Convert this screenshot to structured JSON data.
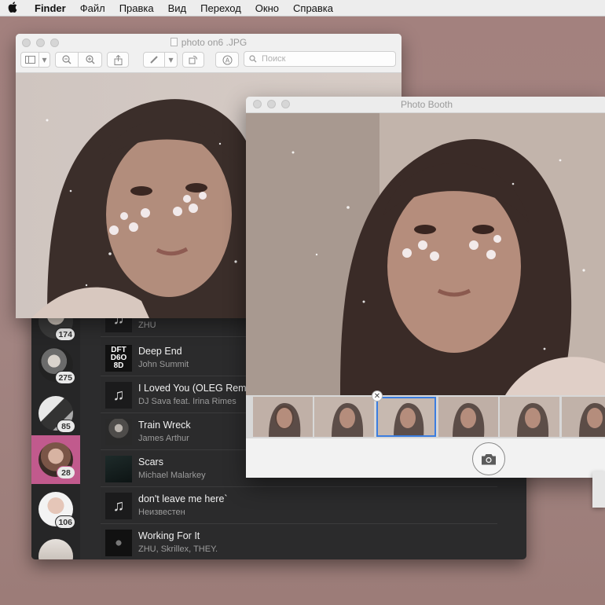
{
  "menubar": {
    "app": "Finder",
    "items": [
      "Файл",
      "Правка",
      "Вид",
      "Переход",
      "Окно",
      "Справка"
    ]
  },
  "preview": {
    "title": "photo on6 .JPG",
    "search_placeholder": "Поиск",
    "toolbar_icons": [
      "sidebar-icon",
      "zoom-out-icon",
      "zoom-in-icon",
      "share-icon",
      "markup-pen-icon",
      "rotate-icon",
      "annotate-icon",
      "search-icon"
    ]
  },
  "booth": {
    "title": "Photo Booth",
    "thumbnail_count": 6,
    "selected_thumbnail": 3
  },
  "music": {
    "playlists": [
      {
        "badge": "174",
        "active": false
      },
      {
        "badge": "275",
        "active": false
      },
      {
        "badge": "85",
        "active": false
      },
      {
        "badge": "28",
        "active": true
      },
      {
        "badge": "106",
        "active": false
      },
      {
        "badge": "",
        "active": false
      }
    ],
    "tracks": [
      {
        "title": "",
        "artist": "ZHU",
        "art": "note-icon"
      },
      {
        "title": "Deep End",
        "artist": "John Summit",
        "art": "album-art"
      },
      {
        "title": "I Loved You (OLEG Remix",
        "artist": "DJ Sava feat. Irina Rimes",
        "art": "note-icon"
      },
      {
        "title": "Train Wreck",
        "artist": "James Arthur",
        "art": "album-art"
      },
      {
        "title": "Scars",
        "artist": "Michael Malarkey",
        "art": "album-art"
      },
      {
        "title": "don't leave me here`",
        "artist": "Неизвестен",
        "art": "note-icon"
      },
      {
        "title": "Working For It",
        "artist": "ZHU, Skrillex, THEY.",
        "art": "album-art"
      }
    ],
    "album_text": "DFT D6O 8D"
  },
  "colors": {
    "desktop": "#a3817e",
    "active_playlist": "#c15a8d",
    "music_bg": "#2b2b2c",
    "selection": "#3b7ddf"
  }
}
